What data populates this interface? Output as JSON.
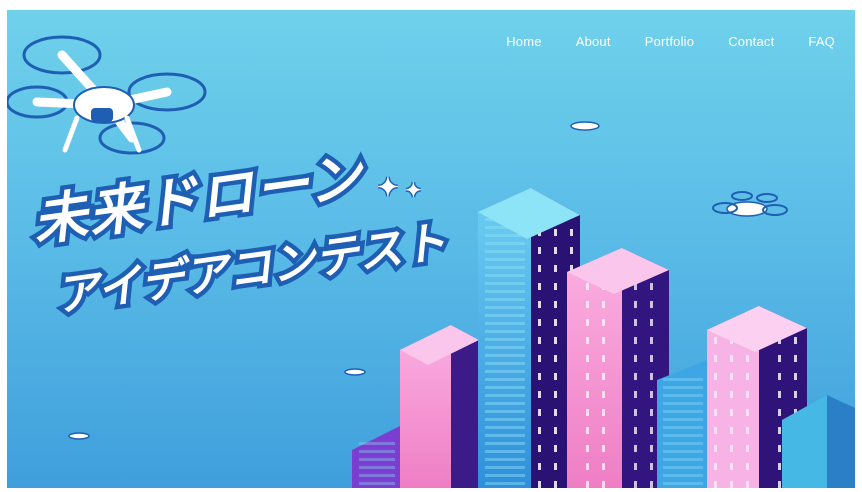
{
  "nav": {
    "items": [
      {
        "label": "Home"
      },
      {
        "label": "About"
      },
      {
        "label": "Portfolio"
      },
      {
        "label": "Contact"
      },
      {
        "label": "FAQ"
      }
    ]
  },
  "hero": {
    "title_line1": "未来ドローン",
    "title_line2": "アイデアコンテスト"
  },
  "colors": {
    "sky_top": "#6fd1ea",
    "sky_bottom": "#3f9fdc",
    "title_outline": "#1f5fb3",
    "building_pink": "#f58ed0",
    "building_purple": "#3a1a86",
    "building_blue": "#3fa6e6"
  },
  "icons": [
    "drone-icon",
    "sparkle-icon",
    "sparkle-icon"
  ]
}
